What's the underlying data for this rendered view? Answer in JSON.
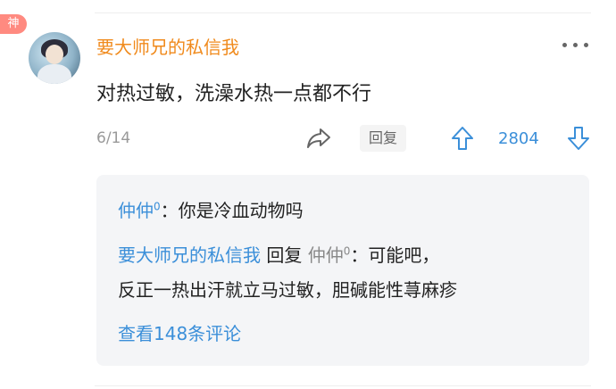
{
  "comment": {
    "badge": "神",
    "username": "要大师兄的私信我",
    "text": "对热过敏，洗澡水热一点都不行",
    "floor": "6/14",
    "reply_label": "回复",
    "upvotes": "2804"
  },
  "replies": [
    {
      "author": "仲仲",
      "author_level": "0",
      "separator": "：",
      "text": "你是冷血动物吗"
    },
    {
      "author": "要大师兄的私信我",
      "reply_word": " 回复 ",
      "target": "仲仲",
      "target_level": "0",
      "separator": "：",
      "text_line1": "可能吧，",
      "text_line2": "反正一热出汗就立马过敏，胆碱能性荨麻疹"
    }
  ],
  "view_more": "查看148条评论",
  "colors": {
    "username": "#f08a1c",
    "link_blue": "#3b8fd9",
    "reply_bg": "#f4f5f7",
    "badge_bg": "#ff8a80"
  },
  "icons": [
    "more-icon",
    "share-icon",
    "upvote-icon",
    "downvote-icon"
  ]
}
